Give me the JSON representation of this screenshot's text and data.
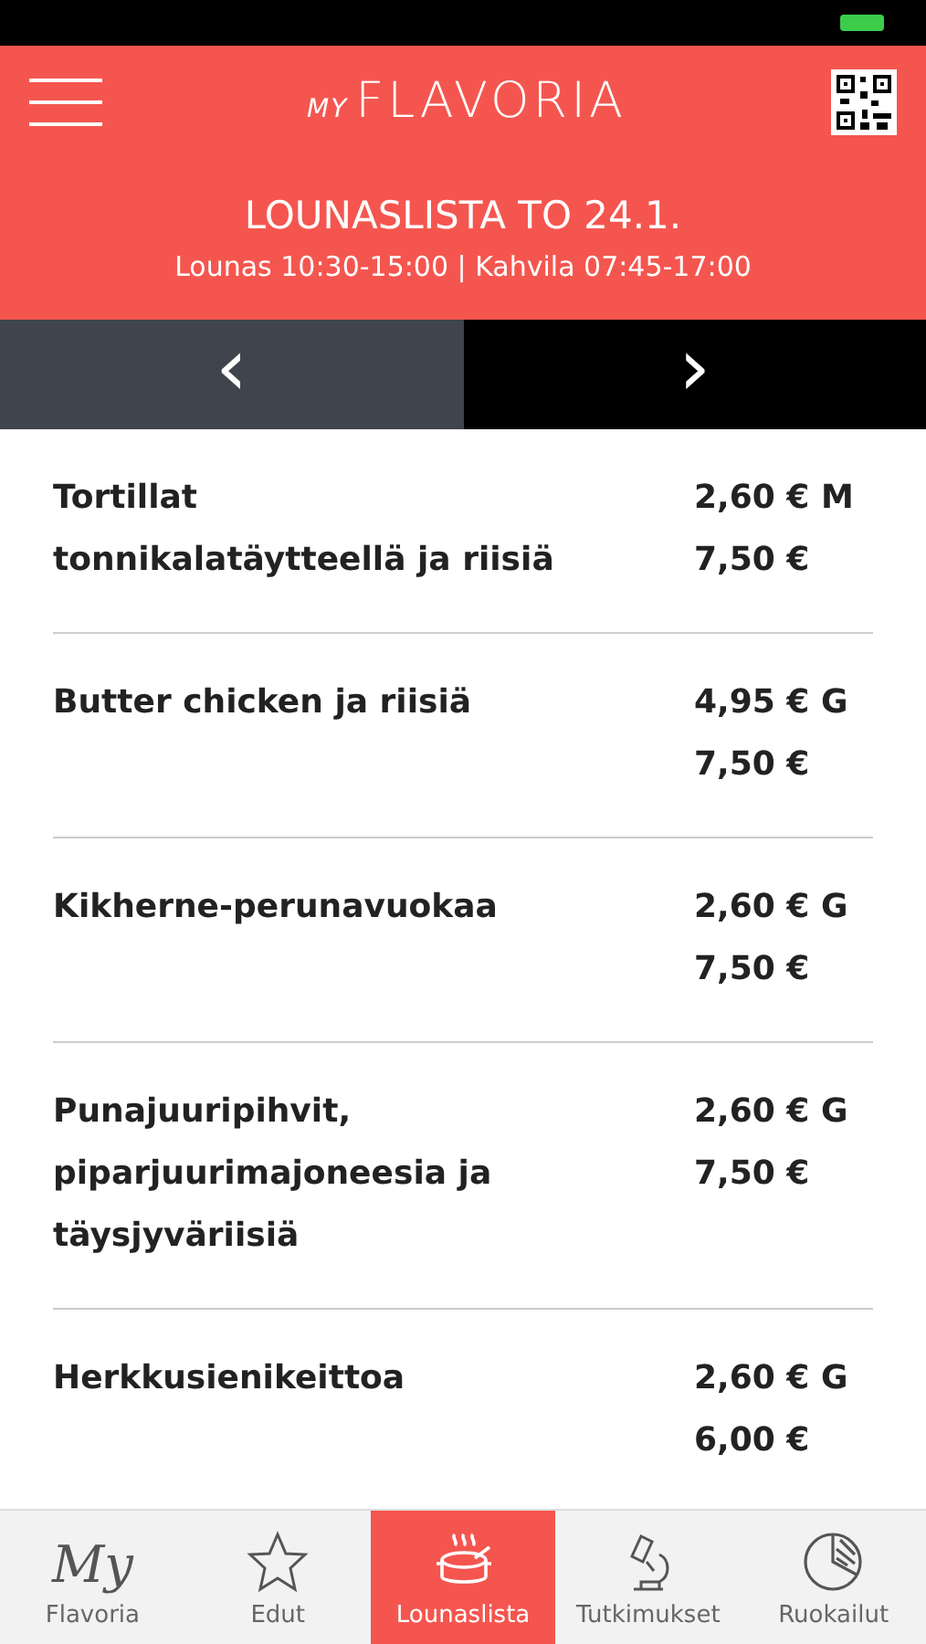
{
  "header": {
    "logo_small": "MY",
    "logo": "FLAVORIA",
    "title": "LOUNASLISTA TO 24.1.",
    "hours": "Lounas 10:30-15:00 | Kahvila 07:45-17:00"
  },
  "day_nav": {
    "prev": "‹",
    "next": "›",
    "prev_active": false,
    "next_active": true
  },
  "menu": [
    {
      "name": [
        "Tortillat",
        "tonnikalatäytteellä ja riisiä"
      ],
      "prices": [
        "2,60 € M",
        "7,50 €"
      ]
    },
    {
      "name": [
        "Butter chicken ja riisiä"
      ],
      "prices": [
        "4,95 € G",
        "7,50 €"
      ]
    },
    {
      "name": [
        "Kikherne-perunavuokaa"
      ],
      "prices": [
        "2,60 € G",
        "7,50 €"
      ]
    },
    {
      "name": [
        "Punajuuripihvit,",
        "piparjuurimajoneesia ja",
        "täysjyväriisiä"
      ],
      "prices": [
        "2,60 € G",
        "7,50 €"
      ]
    },
    {
      "name": [
        "Herkkusienikeittoa"
      ],
      "prices": [
        "2,60 € G",
        "6,00 €"
      ]
    }
  ],
  "tabs": [
    {
      "kind": "text",
      "icon_text": "My",
      "label": "Flavoria",
      "selected": false
    },
    {
      "kind": "star",
      "label": "Edut",
      "selected": false
    },
    {
      "kind": "pot",
      "label": "Lounaslista",
      "selected": true
    },
    {
      "kind": "microscope",
      "label": "Tutkimukset",
      "selected": false
    },
    {
      "kind": "pie",
      "label": "Ruokailut",
      "selected": false
    }
  ]
}
